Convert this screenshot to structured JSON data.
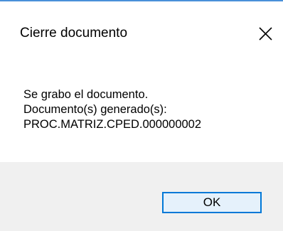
{
  "dialog": {
    "title": "Cierre documento",
    "message_lines": [
      "Se grabo el documento.",
      "Documento(s) generado(s):",
      "PROC.MATRIZ.CPED.000000002"
    ],
    "ok_label": "OK"
  },
  "icons": {
    "close": "close-icon"
  },
  "colors": {
    "accent_border": "#0078d7",
    "button_background": "#e5f1fb",
    "footer_background": "#f0f0f0"
  }
}
